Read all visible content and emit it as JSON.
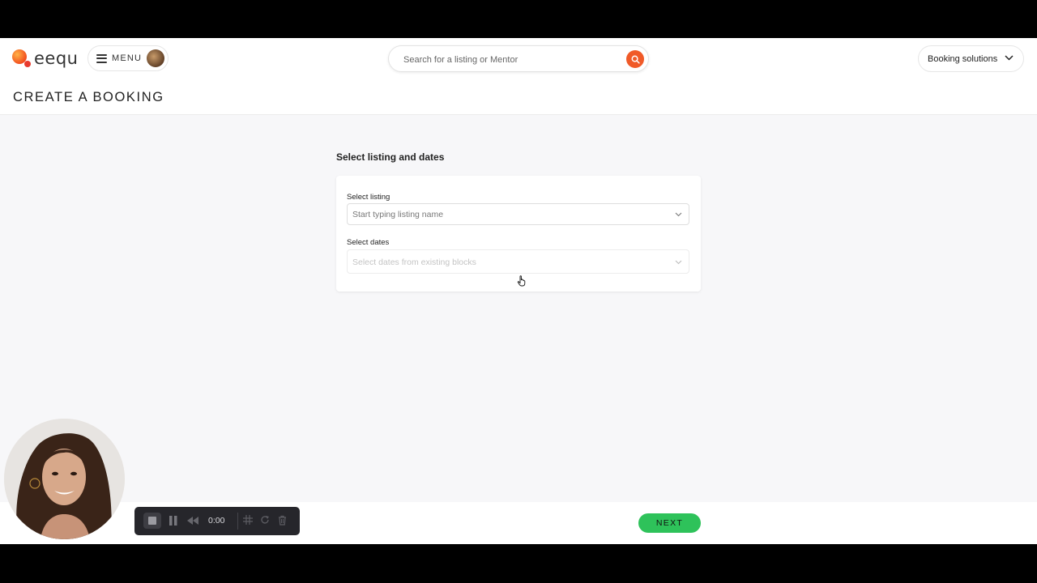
{
  "brand": {
    "name": "eequ"
  },
  "header": {
    "menu_label": "MENU",
    "search_placeholder": "Search for a listing or Mentor",
    "booking_solutions_label": "Booking solutions"
  },
  "page": {
    "title": "CREATE A BOOKING"
  },
  "form": {
    "section_title": "Select listing and dates",
    "listing": {
      "label": "Select listing",
      "placeholder": "Start typing listing name"
    },
    "dates": {
      "label": "Select dates",
      "placeholder": "Select dates from existing blocks",
      "disabled": true
    }
  },
  "footer": {
    "next_label": "NEXT"
  },
  "recorder": {
    "time": "0:00"
  },
  "colors": {
    "accent": "#f05a28",
    "next": "#2ec25a"
  }
}
